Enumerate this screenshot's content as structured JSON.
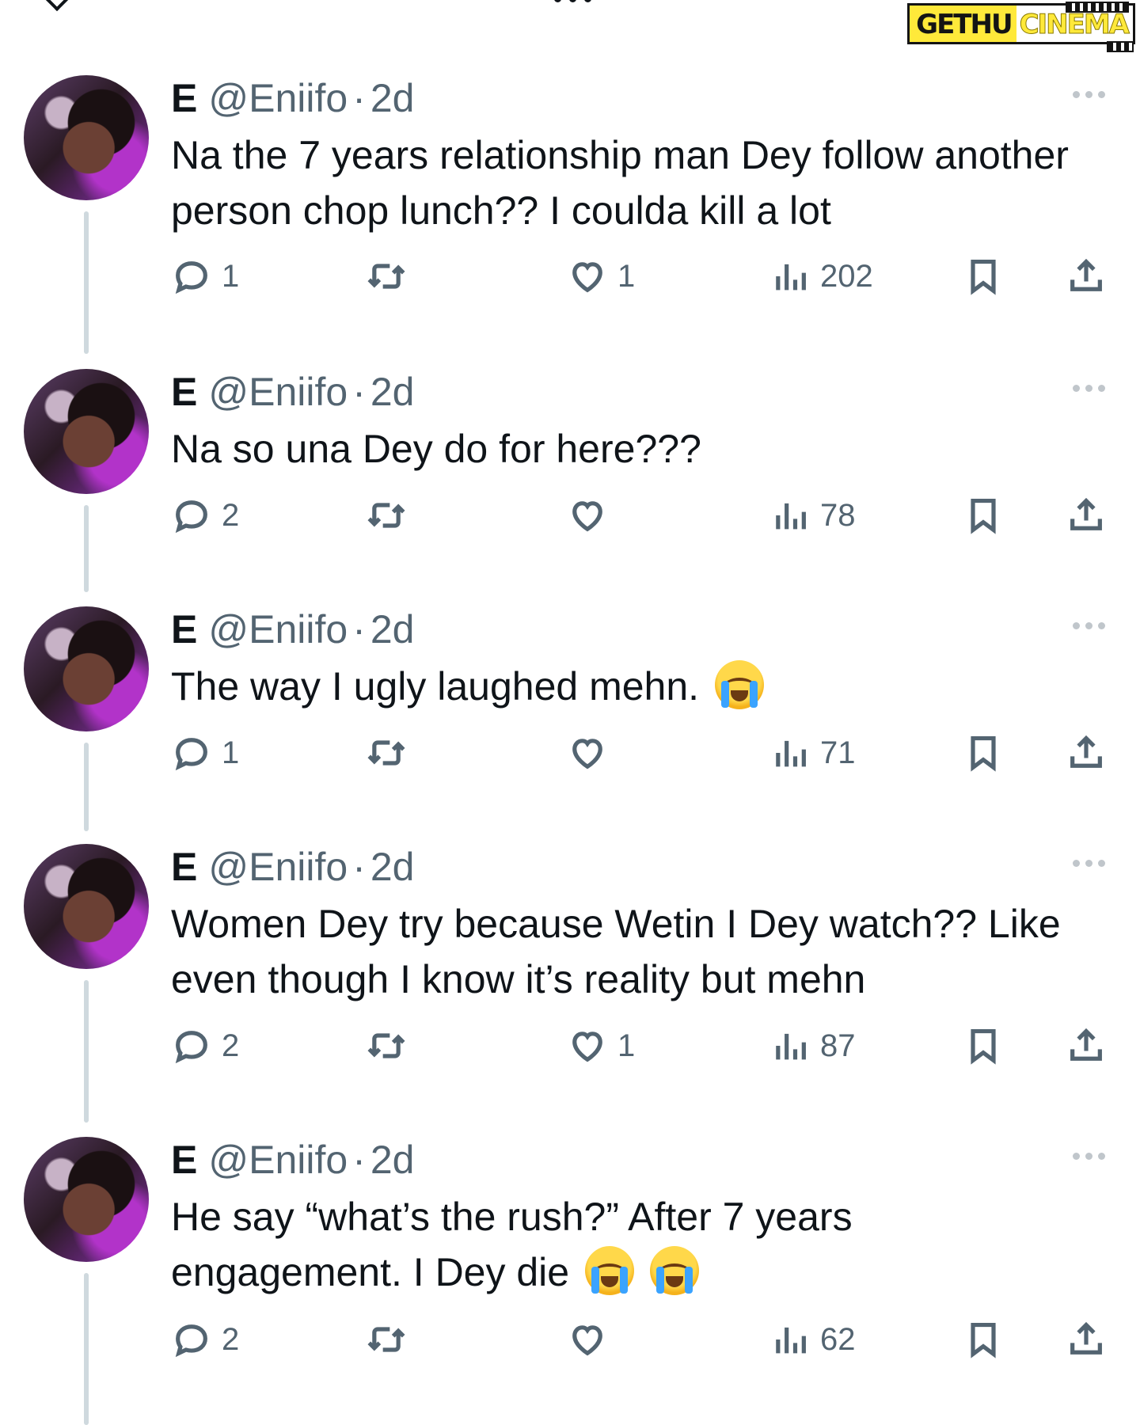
{
  "watermark": {
    "left": "GETHU",
    "right": "CINEMA"
  },
  "tweets": [
    {
      "name": "E",
      "handle": "@Eniifo",
      "separator": "·",
      "time": "2d",
      "text": "Na the 7 years relationship man Dey follow another person  chop lunch?? I coulda kill a lot",
      "replies": "1",
      "retweets": "",
      "likes": "1",
      "views": "202"
    },
    {
      "name": "E",
      "handle": "@Eniifo",
      "separator": "·",
      "time": "2d",
      "text": "Na so una Dey do for here???",
      "replies": "2",
      "retweets": "",
      "likes": "",
      "views": "78"
    },
    {
      "name": "E",
      "handle": "@Eniifo",
      "separator": "·",
      "time": "2d",
      "text": "The way I ugly laughed mehn.",
      "emoji_count": 1,
      "replies": "1",
      "retweets": "",
      "likes": "",
      "views": "71"
    },
    {
      "name": "E",
      "handle": "@Eniifo",
      "separator": "·",
      "time": "2d",
      "text": "Women Dey try because Wetin I Dey watch?? Like even though I know it’s reality but mehn",
      "replies": "2",
      "retweets": "",
      "likes": "1",
      "views": "87"
    },
    {
      "name": "E",
      "handle": "@Eniifo",
      "separator": "·",
      "time": "2d",
      "text": "He say “what’s the rush?” After 7 years engagement. I Dey die",
      "emoji_count": 2,
      "replies": "2",
      "retweets": "",
      "likes": "",
      "views": "62"
    }
  ],
  "icons": {
    "reply": "reply-icon",
    "retweet": "retweet-icon",
    "like": "heart-icon",
    "views": "views-icon",
    "bookmark": "bookmark-icon",
    "share": "share-icon",
    "more": "more-icon"
  },
  "colors": {
    "text": "#0f1419",
    "muted": "#536471",
    "thread": "#cfd9de"
  }
}
